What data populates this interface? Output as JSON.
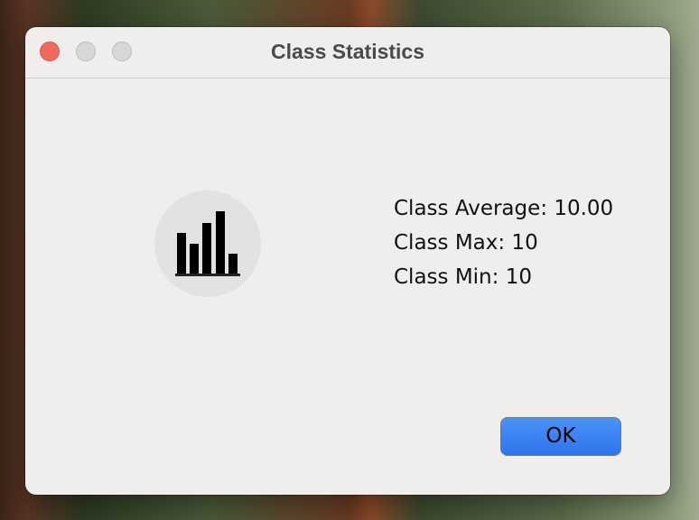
{
  "window": {
    "title": "Class Statistics"
  },
  "stats": {
    "average": "Class Average: 10.00",
    "max": "Class Max: 10",
    "min": "Class Min: 10"
  },
  "buttons": {
    "ok": "OK"
  },
  "icon": "bar-chart-icon",
  "colors": {
    "close": "#ee6a5f",
    "ok_button": "#3a82f2"
  }
}
